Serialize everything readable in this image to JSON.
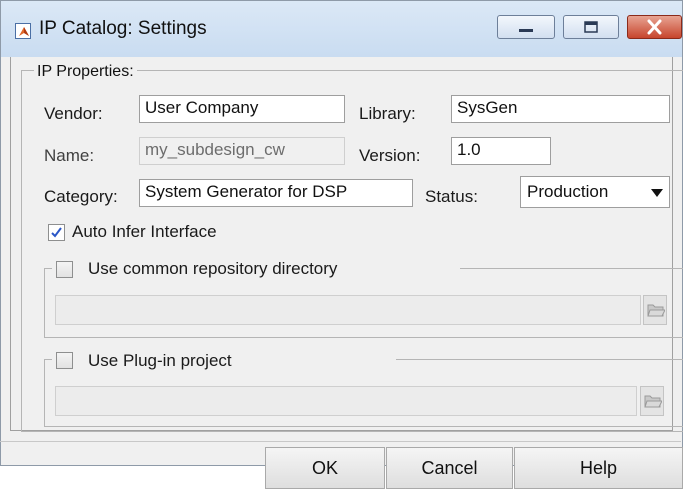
{
  "window": {
    "title": "IP Catalog: Settings",
    "icon": "matlab-icon",
    "controls": [
      "minimize-icon",
      "maximize-icon",
      "close-icon"
    ]
  },
  "ip_properties": {
    "group_label": "IP Properties:",
    "vendor_label": "Vendor:",
    "vendor_value": "User Company",
    "library_label": "Library:",
    "library_value": "SysGen",
    "name_label": "Name:",
    "name_value": "my_subdesign_cw",
    "version_label": "Version:",
    "version_value": "1.0",
    "category_label": "Category:",
    "category_value": "System Generator for DSP",
    "status_label": "Status:",
    "status_value": "Production",
    "auto_infer_label": "Auto Infer Interface",
    "auto_infer_checked": true
  },
  "common_repo": {
    "label": "Use common repository directory",
    "checked": false,
    "path_value": ""
  },
  "plugin_project": {
    "label": "Use Plug-in project",
    "checked": false,
    "path_value": ""
  },
  "buttons": {
    "ok": "OK",
    "cancel": "Cancel",
    "help": "Help"
  },
  "colors": {
    "title_bar": "#d2e2f4",
    "close_button": "#c7452d",
    "dialog_background": "#f0f0f0"
  }
}
